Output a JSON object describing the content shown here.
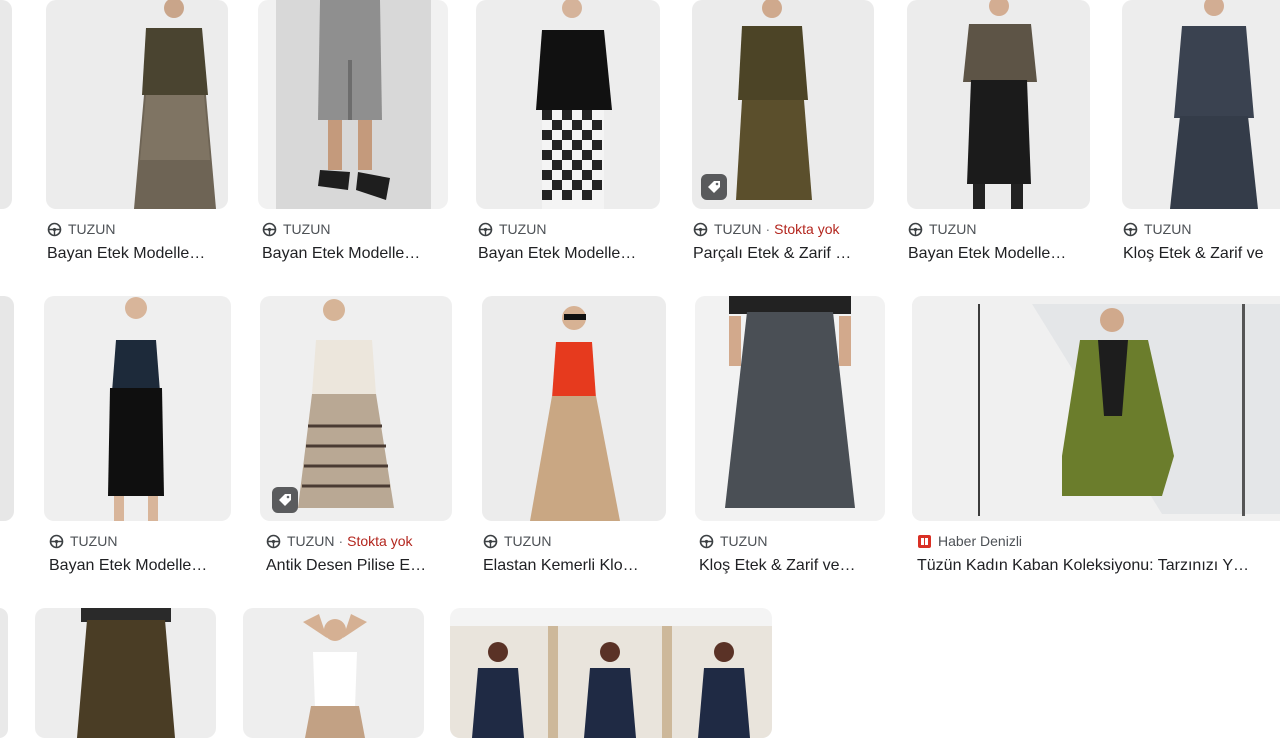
{
  "colors": {
    "stock": "#b3261e",
    "source": "#4d5156",
    "title": "#202124"
  },
  "icons": {
    "favicon": "wheel-logo-icon",
    "deal": "price-tag-icon",
    "news": "haber-denizli-logo-icon"
  },
  "rows": [
    {
      "cards": [
        {
          "source": "TUZUN",
          "title": "Bayan Etek Modelle…",
          "stock": ""
        },
        {
          "source": "TUZUN",
          "title": "Bayan Etek Modelle…",
          "stock": ""
        },
        {
          "source": "TUZUN",
          "title": "Bayan Etek Modelle…",
          "stock": ""
        },
        {
          "source": "TUZUN",
          "title": "Parçalı Etek & Zarif …",
          "stock": "Stokta yok"
        },
        {
          "source": "TUZUN",
          "title": "Bayan Etek Modelle…",
          "stock": ""
        },
        {
          "source": "TUZUN",
          "title": "Kloş Etek & Zarif ve",
          "stock": ""
        }
      ]
    },
    {
      "cards": [
        {
          "source": "TUZUN",
          "title": "Bayan Etek Modelle…",
          "stock": ""
        },
        {
          "source": "TUZUN",
          "title": "Antik Desen Pilise E…",
          "stock": "Stokta yok"
        },
        {
          "source": "TUZUN",
          "title": "Elastan Kemerli Klo…",
          "stock": ""
        },
        {
          "source": "TUZUN",
          "title": "Kloş Etek & Zarif ve…",
          "stock": ""
        },
        {
          "source": "Haber Denizli",
          "title": "Tüzün Kadın Kaban Koleksiyonu: Tarzınızı Y…",
          "stock": ""
        }
      ]
    }
  ]
}
